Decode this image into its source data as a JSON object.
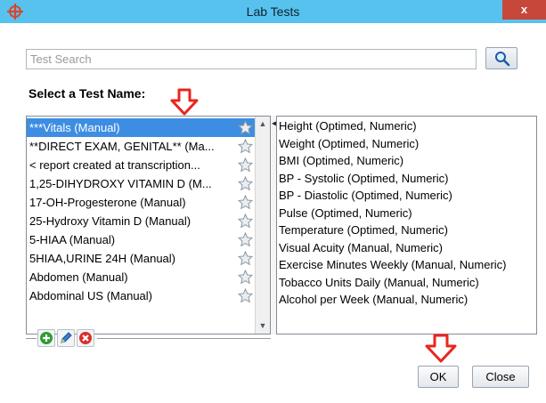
{
  "window": {
    "title": "Lab Tests",
    "close_label": "x",
    "titlebar_color": "#57c2ee",
    "close_color": "#c7473a"
  },
  "search": {
    "placeholder": "Test Search",
    "button_icon": "magnifier-icon"
  },
  "section_label": "Select a Test Name:",
  "test_list": {
    "items": [
      {
        "label": "***Vitals (Manual)",
        "selected": true
      },
      {
        "label": "**DIRECT EXAM, GENITAL** (Ma...",
        "selected": false
      },
      {
        "label": "<  report created at transcription...",
        "selected": false
      },
      {
        "label": "1,25-DIHYDROXY VITAMIN D (M...",
        "selected": false
      },
      {
        "label": "17-OH-Progesterone (Manual)",
        "selected": false
      },
      {
        "label": "25-Hydroxy Vitamin D (Manual)",
        "selected": false
      },
      {
        "label": "5-HIAA (Manual)",
        "selected": false
      },
      {
        "label": "5HIAA,URINE 24H (Manual)",
        "selected": false
      },
      {
        "label": "Abdomen (Manual)",
        "selected": false
      },
      {
        "label": "Abdominal US (Manual)",
        "selected": false
      }
    ],
    "selected_color": "#3d8ee2",
    "star_icon": "star-icon"
  },
  "list_toolbar": {
    "add_icon": "add-icon",
    "edit_icon": "pencil-icon",
    "delete_icon": "delete-icon"
  },
  "detail_list": {
    "items": [
      "Height (Optimed, Numeric)",
      "Weight (Optimed, Numeric)",
      "BMI (Optimed, Numeric)",
      "BP - Systolic (Optimed, Numeric)",
      "BP - Diastolic (Optimed, Numeric)",
      "Pulse (Optimed, Numeric)",
      "Temperature (Optimed, Numeric)",
      "Visual Acuity (Manual, Numeric)",
      "Exercise Minutes Weekly (Manual, Numeric)",
      "Tobacco Units Daily (Manual, Numeric)",
      "Alcohol per Week (Manual, Numeric)"
    ]
  },
  "buttons": {
    "ok": "OK",
    "close": "Close"
  },
  "annotation_arrow_color": "#e8261f"
}
